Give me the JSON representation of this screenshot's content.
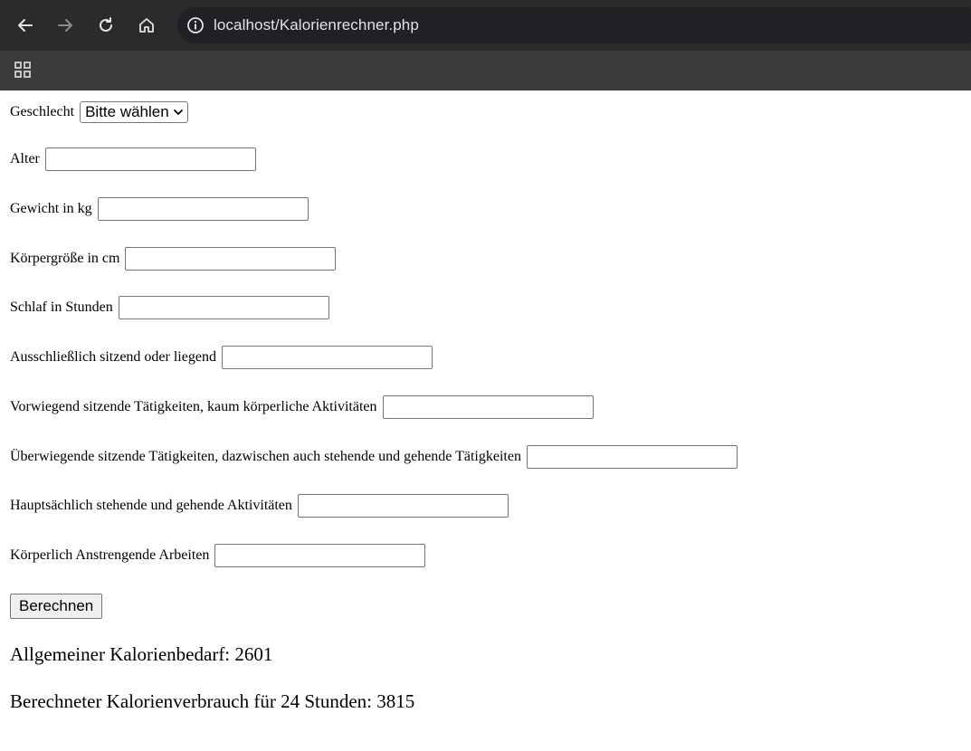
{
  "browser": {
    "url": "localhost/Kalorienrechner.php"
  },
  "form": {
    "gender": {
      "label": "Geschlecht",
      "selected": "Bitte wählen"
    },
    "fields": [
      {
        "label": "Alter",
        "value": ""
      },
      {
        "label": "Gewicht in kg",
        "value": ""
      },
      {
        "label": "Körpergröße in cm",
        "value": ""
      },
      {
        "label": "Schlaf in Stunden",
        "value": ""
      },
      {
        "label": "Ausschließlich sitzend oder liegend",
        "value": ""
      },
      {
        "label": "Vorwiegend sitzende Tätigkeiten, kaum körperliche Aktivitäten",
        "value": ""
      },
      {
        "label": "Überwiegende sitzende Tätigkeiten, dazwischen auch stehende und gehende Tätigkeiten",
        "value": ""
      },
      {
        "label": "Hauptsächlich stehende und gehende Aktivitäten",
        "value": ""
      },
      {
        "label": "Körperlich Anstrengende Arbeiten",
        "value": ""
      }
    ],
    "submit_label": "Berechnen"
  },
  "results": {
    "general": "Allgemeiner Kalorienbedarf: 2601",
    "computed": "Berechneter Kalorienverbrauch für 24 Stunden: 3815"
  }
}
